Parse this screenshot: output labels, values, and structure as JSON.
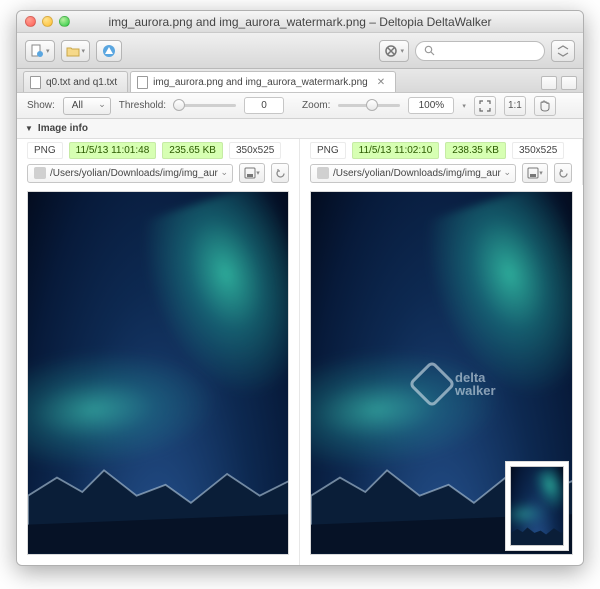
{
  "window": {
    "title": "img_aurora.png and img_aurora_watermark.png – Deltopia DeltaWalker"
  },
  "tabs": {
    "inactive": "q0.txt and q1.txt",
    "active": "img_aurora.png and img_aurora_watermark.png"
  },
  "controls": {
    "show_label": "Show:",
    "show_value": "All",
    "threshold_label": "Threshold:",
    "threshold_value": "0",
    "zoom_label": "Zoom:",
    "zoom_value": "100%",
    "onetoone": "1:1"
  },
  "info_header": "Image info",
  "left": {
    "format": "PNG",
    "timestamp": "11/5/13 11:01:48",
    "size": "235.65 KB",
    "dimensions": "350x525",
    "path": "/Users/yolian/Downloads/img/img_aur"
  },
  "right": {
    "format": "PNG",
    "timestamp": "11/5/13 11:02:10",
    "size": "238.35 KB",
    "dimensions": "350x525",
    "path": "/Users/yolian/Downloads/img/img_aur"
  },
  "watermark": {
    "line1": "delta",
    "line2": "walker"
  }
}
